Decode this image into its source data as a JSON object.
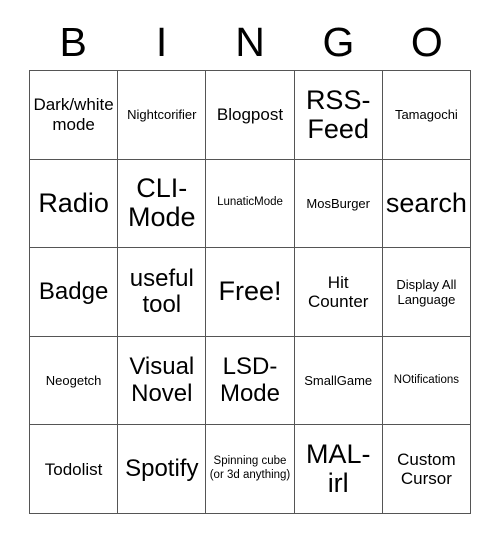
{
  "card": {
    "title_letters": [
      "B",
      "I",
      "N",
      "G",
      "O"
    ],
    "columns": 5,
    "rows": 5,
    "border_color": "#555555",
    "text_color": "#000000",
    "background_color": "#ffffff",
    "cells": [
      [
        {
          "label": "Dark/white mode",
          "size": "md"
        },
        {
          "label": "Nightcorifier",
          "size": "sm"
        },
        {
          "label": "Blogpost",
          "size": "md"
        },
        {
          "label": "RSS-Feed",
          "size": "xl"
        },
        {
          "label": "Tamagochi",
          "size": "sm"
        }
      ],
      [
        {
          "label": "Radio",
          "size": "xl"
        },
        {
          "label": "CLI-Mode",
          "size": "xl"
        },
        {
          "label": "LunaticMode",
          "size": "xs"
        },
        {
          "label": "MosBurger",
          "size": "sm"
        },
        {
          "label": "search",
          "size": "xl"
        }
      ],
      [
        {
          "label": "Badge",
          "size": "lg"
        },
        {
          "label": "useful tool",
          "size": "lg"
        },
        {
          "label": "Free!",
          "size": "xl"
        },
        {
          "label": "Hit Counter",
          "size": "md"
        },
        {
          "label": "Display All Language",
          "size": "sm"
        }
      ],
      [
        {
          "label": "Neogetch",
          "size": "sm"
        },
        {
          "label": "Visual Novel",
          "size": "lg"
        },
        {
          "label": "LSD-Mode",
          "size": "lg"
        },
        {
          "label": "SmallGame",
          "size": "sm"
        },
        {
          "label": "NOtifications",
          "size": "xs"
        }
      ],
      [
        {
          "label": "Todolist",
          "size": "md"
        },
        {
          "label": "Spotify",
          "size": "lg"
        },
        {
          "label": "Spinning cube (or 3d anything)",
          "size": "xs"
        },
        {
          "label": "MAL-irl",
          "size": "xl"
        },
        {
          "label": "Custom Cursor",
          "size": "md"
        }
      ]
    ]
  }
}
